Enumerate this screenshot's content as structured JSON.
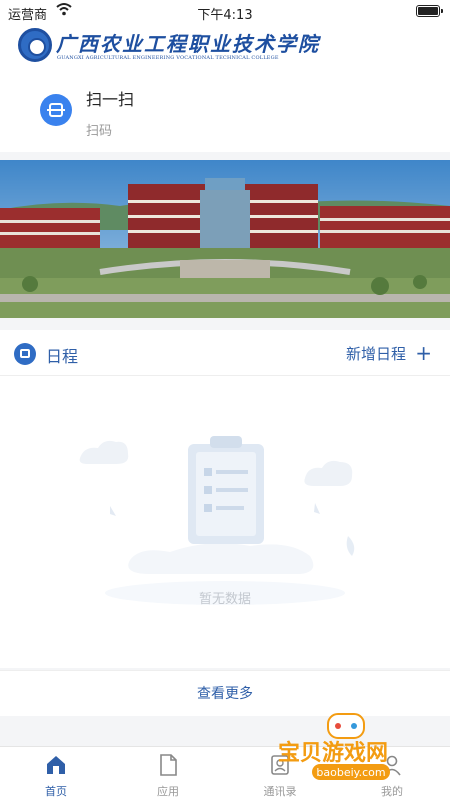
{
  "status_bar": {
    "carrier": "运营商",
    "time": "下午4:13"
  },
  "header": {
    "school_name": "广西农业工程职业技术学院",
    "school_name_en": "GUANGXI AGRICULTURAL ENGINEERING VOCATIONAL TECHNICAL COLLEGE"
  },
  "scan": {
    "title": "扫一扫",
    "subtitle": "扫码"
  },
  "schedule": {
    "label": "日程",
    "add_label": "新增日程",
    "empty_text": "暂无数据"
  },
  "more_label": "查看更多",
  "tabs": [
    {
      "label": "首页",
      "icon": "home-icon",
      "active": true
    },
    {
      "label": "应用",
      "icon": "document-icon",
      "active": false
    },
    {
      "label": "通讯录",
      "icon": "contacts-icon",
      "active": false
    },
    {
      "label": "我的",
      "icon": "user-icon",
      "active": false
    }
  ],
  "watermark": {
    "title": "宝贝游戏网",
    "url": "baobeiy.com"
  },
  "colors": {
    "accent": "#2f5fa8",
    "scan_icon": "#3a82ee",
    "inactive": "#999999"
  }
}
